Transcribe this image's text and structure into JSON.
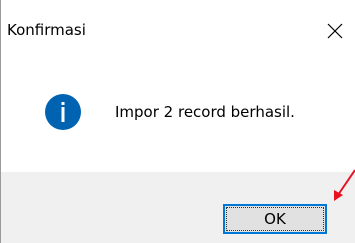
{
  "dialog": {
    "title": "Konfirmasi",
    "message": "Impor 2 record berhasil.",
    "icon": "info-icon",
    "ok_label": "OK",
    "close_icon": "close-icon"
  },
  "colors": {
    "icon_blue": "#0063b1",
    "button_focus_border": "#0078d7",
    "footer_bg": "#f0f0f0",
    "annotation_arrow": "#e81123"
  }
}
